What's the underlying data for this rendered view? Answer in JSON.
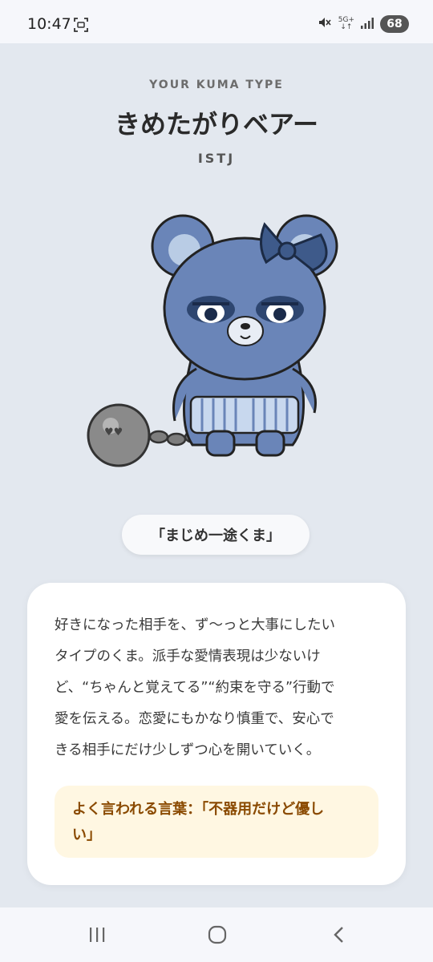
{
  "status": {
    "time": "10:47",
    "network": "5G+",
    "battery": "68"
  },
  "header": {
    "eyebrow": "YOUR KUMA TYPE",
    "type_name": "きめたがりベアー",
    "code": "ISTJ"
  },
  "nickname": "「まじめ一途くま」",
  "description": {
    "lines": [
      "好きになった相手を、ず〜っと大事にしたい",
      "タイプのくま。派手な愛情表現は少ないけ",
      "ど、“ちゃんと覚えてる”“約束を守る”行動で",
      "愛を伝える。恋愛にもかなり慎重で、安心で",
      "きる相手にだけ少しずつ心を開いていく。"
    ]
  },
  "quote": {
    "lines": [
      "よく言われる言葉：「不器用だけど優し",
      "い」"
    ]
  },
  "icons": {
    "screenshot": "screen-capture-icon",
    "mute": "mute-icon",
    "signal": "signal-icon",
    "recents": "recents-icon",
    "home": "home-icon",
    "back": "back-icon",
    "bear": "bear-illustration"
  },
  "colors": {
    "background": "#e3e8ef",
    "bear_body": "#6a85b8",
    "quote_bg": "#fff7e2",
    "quote_text": "#8a4a00"
  }
}
